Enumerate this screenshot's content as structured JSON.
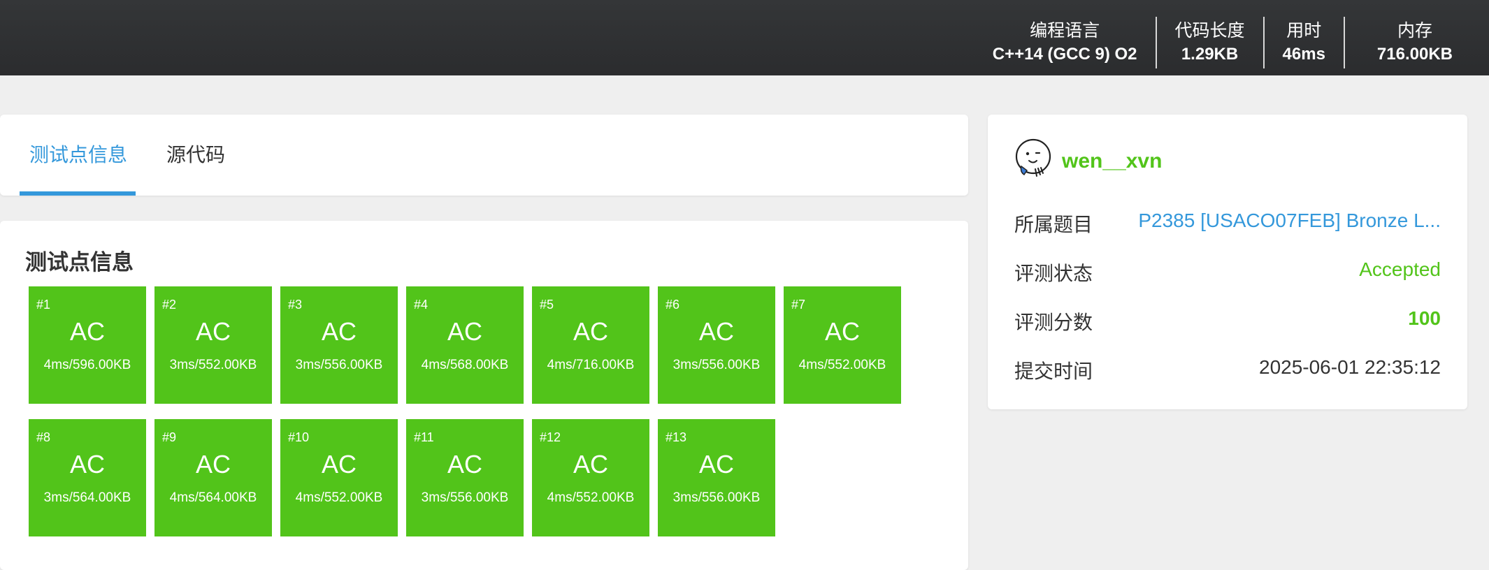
{
  "header": {
    "stats": [
      {
        "label": "编程语言",
        "value": "C++14 (GCC 9) O2"
      },
      {
        "label": "代码长度",
        "value": "1.29KB"
      },
      {
        "label": "用时",
        "value": "46ms"
      },
      {
        "label": "内存",
        "value": "716.00KB"
      }
    ]
  },
  "tabs": {
    "active": "测试点信息",
    "source": "源代码"
  },
  "testcases": {
    "title": "测试点信息",
    "status_color": "#52c41a",
    "items": [
      {
        "num": "#1",
        "status": "AC",
        "info": "4ms/596.00KB"
      },
      {
        "num": "#2",
        "status": "AC",
        "info": "3ms/552.00KB"
      },
      {
        "num": "#3",
        "status": "AC",
        "info": "3ms/556.00KB"
      },
      {
        "num": "#4",
        "status": "AC",
        "info": "4ms/568.00KB"
      },
      {
        "num": "#5",
        "status": "AC",
        "info": "4ms/716.00KB"
      },
      {
        "num": "#6",
        "status": "AC",
        "info": "3ms/556.00KB"
      },
      {
        "num": "#7",
        "status": "AC",
        "info": "4ms/552.00KB"
      },
      {
        "num": "#8",
        "status": "AC",
        "info": "3ms/564.00KB"
      },
      {
        "num": "#9",
        "status": "AC",
        "info": "4ms/564.00KB"
      },
      {
        "num": "#10",
        "status": "AC",
        "info": "4ms/552.00KB"
      },
      {
        "num": "#11",
        "status": "AC",
        "info": "3ms/556.00KB"
      },
      {
        "num": "#12",
        "status": "AC",
        "info": "4ms/552.00KB"
      },
      {
        "num": "#13",
        "status": "AC",
        "info": "3ms/556.00KB"
      }
    ]
  },
  "submission": {
    "username": "wen__xvn",
    "avatar_icon": "doodle-face-avatar-icon",
    "rows": [
      {
        "key": "所属题目",
        "value": "P2385 [USACO07FEB] Bronze L..."
      },
      {
        "key": "评测状态",
        "value": "Accepted"
      },
      {
        "key": "评测分数",
        "value": "100"
      },
      {
        "key": "提交时间",
        "value": "2025-06-01 22:35:12"
      }
    ]
  }
}
